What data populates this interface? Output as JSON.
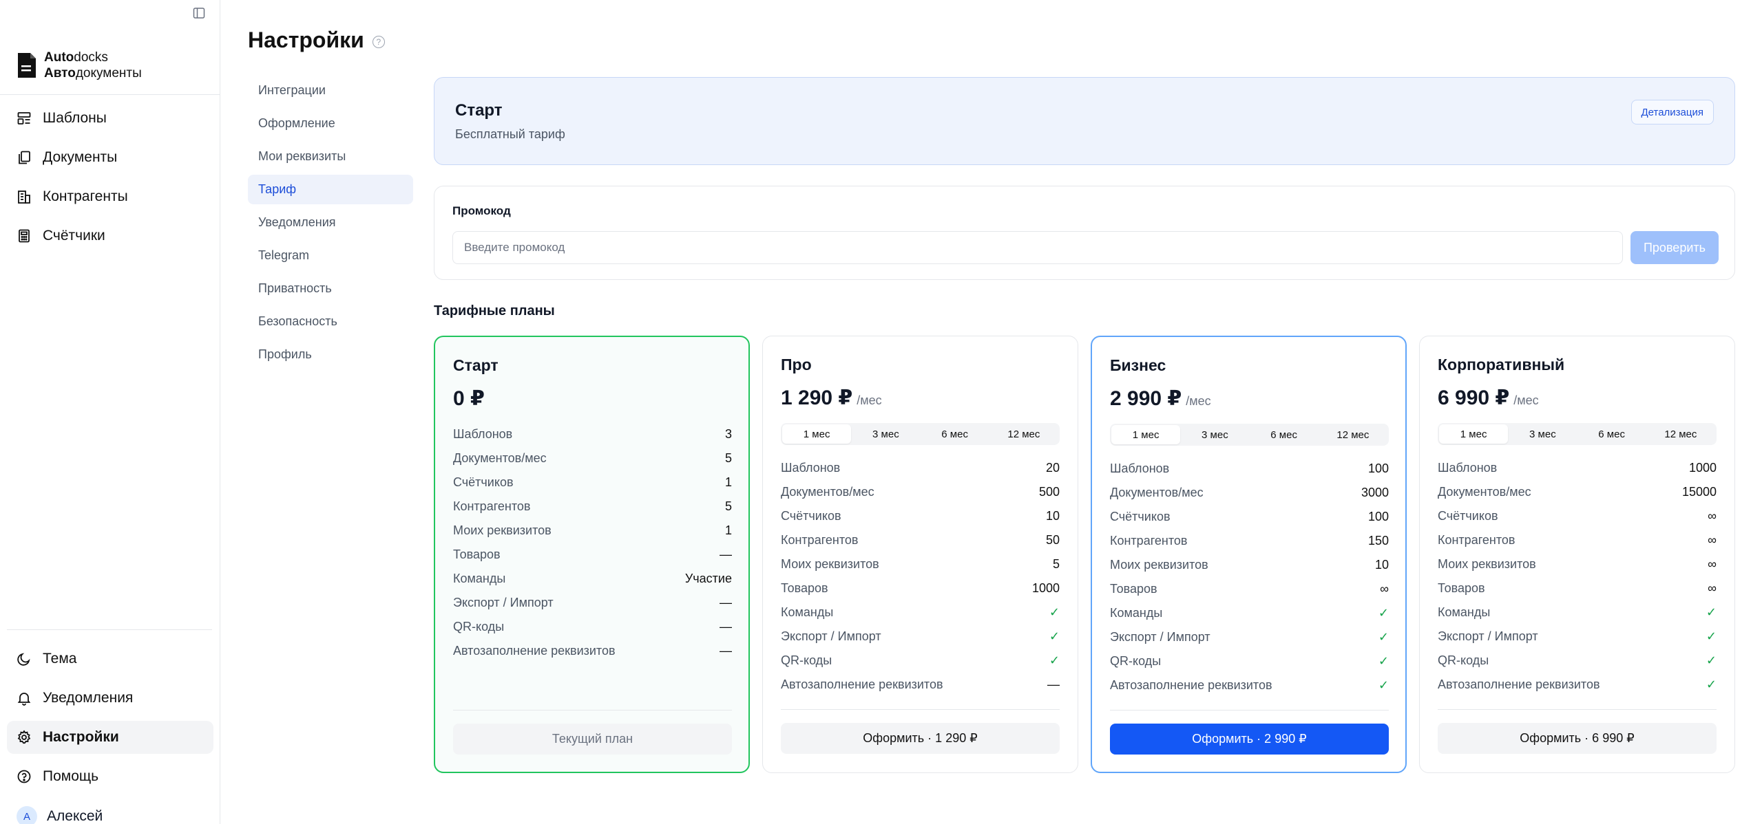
{
  "brand": {
    "line1_bold": "Auto",
    "line1_rest": "docks",
    "line2_bold": "Авто",
    "line2_rest": "документы"
  },
  "sidebar": {
    "items": [
      {
        "label": "Шаблоны",
        "icon": "template-icon"
      },
      {
        "label": "Документы",
        "icon": "documents-icon"
      },
      {
        "label": "Контрагенты",
        "icon": "building-icon"
      },
      {
        "label": "Счётчики",
        "icon": "calculator-icon"
      }
    ],
    "bottom_items": [
      {
        "label": "Тема",
        "icon": "moon-icon"
      },
      {
        "label": "Уведомления",
        "icon": "bell-icon"
      },
      {
        "label": "Настройки",
        "icon": "gear-icon"
      },
      {
        "label": "Помощь",
        "icon": "help-icon"
      }
    ],
    "user": {
      "initial": "A",
      "name": "Алексей"
    }
  },
  "page": {
    "title": "Настройки",
    "help_glyph": "?"
  },
  "subnav": [
    "Интеграции",
    "Оформление",
    "Мои реквизиты",
    "Тариф",
    "Уведомления",
    "Telegram",
    "Приватность",
    "Безопасность",
    "Профиль"
  ],
  "current_plan": {
    "name": "Старт",
    "description": "Бесплатный тариф",
    "details_label": "Детализация"
  },
  "promo": {
    "label": "Промокод",
    "placeholder": "Введите промокод",
    "button": "Проверить"
  },
  "plans_heading": "Тарифные планы",
  "plans": [
    {
      "name": "Старт",
      "price": "0 ₽",
      "unit": "",
      "features": [
        {
          "label": "Шаблонов",
          "value": "3"
        },
        {
          "label": "Документов/мес",
          "value": "5"
        },
        {
          "label": "Счётчиков",
          "value": "1"
        },
        {
          "label": "Контрагентов",
          "value": "5"
        },
        {
          "label": "Моих реквизитов",
          "value": "1"
        },
        {
          "label": "Товаров",
          "value": "—"
        },
        {
          "label": "Команды",
          "value": "Участие"
        },
        {
          "label": "Экспорт / Импорт",
          "value": "—"
        },
        {
          "label": "QR-коды",
          "value": "—"
        },
        {
          "label": "Автозаполнение реквизитов",
          "value": "—"
        }
      ],
      "button": "Текущий план"
    },
    {
      "name": "Про",
      "price": "1 290 ₽",
      "unit": "/мес",
      "features": [
        {
          "label": "Шаблонов",
          "value": "20"
        },
        {
          "label": "Документов/мес",
          "value": "500"
        },
        {
          "label": "Счётчиков",
          "value": "10"
        },
        {
          "label": "Контрагентов",
          "value": "50"
        },
        {
          "label": "Моих реквизитов",
          "value": "5"
        },
        {
          "label": "Товаров",
          "value": "1000"
        },
        {
          "label": "Команды",
          "value": "✓"
        },
        {
          "label": "Экспорт / Импорт",
          "value": "✓"
        },
        {
          "label": "QR-коды",
          "value": "✓"
        },
        {
          "label": "Автозаполнение реквизитов",
          "value": "—"
        }
      ],
      "button": "Оформить · 1 290 ₽"
    },
    {
      "name": "Бизнес",
      "price": "2 990 ₽",
      "unit": "/мес",
      "features": [
        {
          "label": "Шаблонов",
          "value": "100"
        },
        {
          "label": "Документов/мес",
          "value": "3000"
        },
        {
          "label": "Счётчиков",
          "value": "100"
        },
        {
          "label": "Контрагентов",
          "value": "150"
        },
        {
          "label": "Моих реквизитов",
          "value": "10"
        },
        {
          "label": "Товаров",
          "value": "∞"
        },
        {
          "label": "Команды",
          "value": "✓"
        },
        {
          "label": "Экспорт / Импорт",
          "value": "✓"
        },
        {
          "label": "QR-коды",
          "value": "✓"
        },
        {
          "label": "Автозаполнение реквизитов",
          "value": "✓"
        }
      ],
      "button": "Оформить · 2 990 ₽"
    },
    {
      "name": "Корпоративный",
      "price": "6 990 ₽",
      "unit": "/мес",
      "features": [
        {
          "label": "Шаблонов",
          "value": "1000"
        },
        {
          "label": "Документов/мес",
          "value": "15000"
        },
        {
          "label": "Счётчиков",
          "value": "∞"
        },
        {
          "label": "Контрагентов",
          "value": "∞"
        },
        {
          "label": "Моих реквизитов",
          "value": "∞"
        },
        {
          "label": "Товаров",
          "value": "∞"
        },
        {
          "label": "Команды",
          "value": "✓"
        },
        {
          "label": "Экспорт / Импорт",
          "value": "✓"
        },
        {
          "label": "QR-коды",
          "value": "✓"
        },
        {
          "label": "Автозаполнение реквизитов",
          "value": "✓"
        }
      ],
      "button": "Оформить · 6 990 ₽"
    }
  ],
  "periods": [
    "1 мес",
    "3 мес",
    "6 мес",
    "12 мес"
  ],
  "colors": {
    "accent": "#1458f5",
    "current_border": "#22c55e",
    "featured_border": "#60a5fa",
    "check": "#16a34a"
  }
}
